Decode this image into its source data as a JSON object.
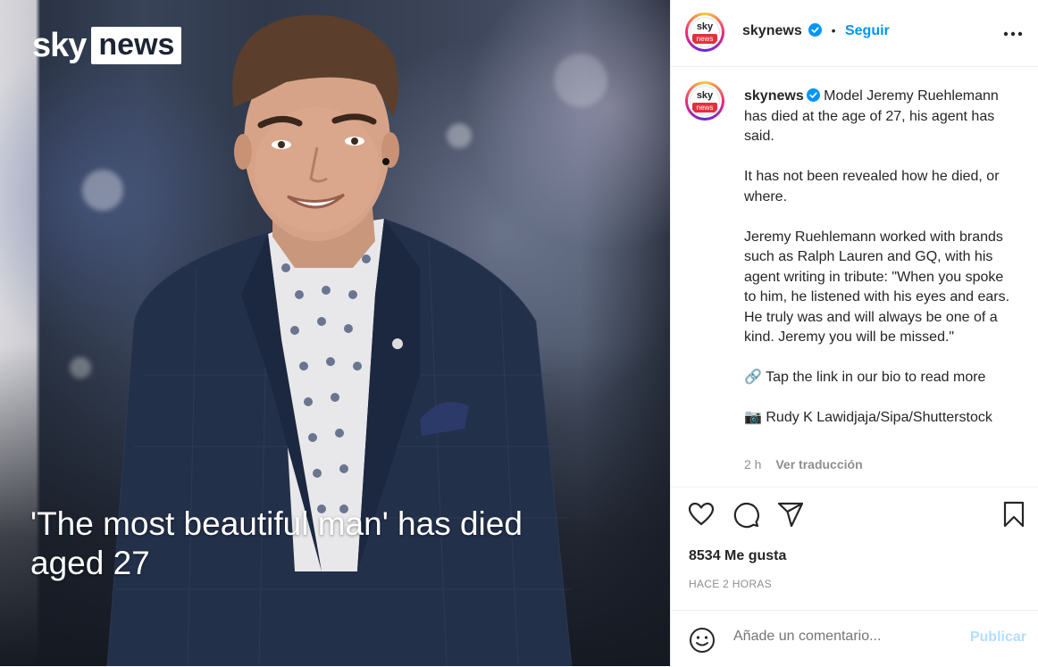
{
  "media": {
    "logo_sky": "sky",
    "logo_news": "news",
    "headline": "'The most beautiful man' has died aged 27"
  },
  "header": {
    "username": "skynews",
    "verified": true,
    "separator": "•",
    "follow_label": "Seguir",
    "more_icon": "more-horizontal-icon"
  },
  "avatar": {
    "top": "sky",
    "bottom": "news"
  },
  "caption": {
    "username": "skynews",
    "paragraphs": [
      "Model Jeremy Ruehlemann has died at the age of 27, his agent has said.",
      "It has not been revealed how he died, or where.",
      "Jeremy Ruehlemann worked with brands such as Ralph Lauren and GQ, with his agent writing in tribute: \"When you spoke to him, he listened with his eyes and ears. He truly was and will always be one of a kind. Jeremy you will be missed.\"",
      "🔗 Tap the link in our bio to read more",
      "📷 Rudy K Lawidjaja/Sipa/Shutterstock"
    ],
    "time": "2 h",
    "translate_label": "Ver traducción"
  },
  "actions": {
    "icons": [
      "heart-icon",
      "comment-icon",
      "share-icon",
      "bookmark-icon"
    ]
  },
  "likes": "8534 Me gusta",
  "posted_ago": "HACE 2 HORAS",
  "comment_box": {
    "placeholder": "Añade un comentario...",
    "post_label": "Publicar"
  },
  "colors": {
    "accent": "#0095f6",
    "post_disabled": "#b2dffc",
    "muted": "#8e8e8e",
    "sky_red": "#e4303b"
  }
}
